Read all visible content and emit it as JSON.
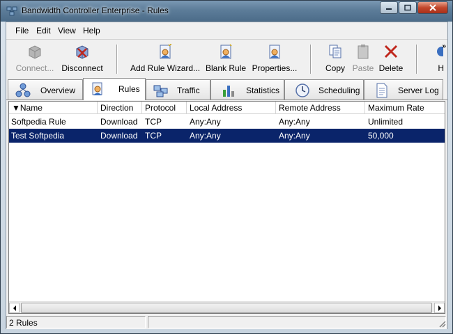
{
  "window": {
    "title": "Bandwidth Controller Enterprise - Rules"
  },
  "menu": {
    "file": "File",
    "edit": "Edit",
    "view": "View",
    "help": "Help"
  },
  "toolbar": {
    "connect": "Connect...",
    "disconnect": "Disconnect",
    "add_rule_wizard": "Add Rule Wizard...",
    "blank_rule": "Blank Rule",
    "properties": "Properties...",
    "copy": "Copy",
    "paste": "Paste",
    "delete": "Delete",
    "help": "H",
    "overflow": "»"
  },
  "tabs": [
    {
      "label": "Overview"
    },
    {
      "label": "Rules"
    },
    {
      "label": "Traffic"
    },
    {
      "label": "Statistics"
    },
    {
      "label": "Scheduling"
    },
    {
      "label": "Server Log"
    }
  ],
  "active_tab": "Rules",
  "list": {
    "sort_indicator": "▼",
    "columns": [
      "Name",
      "Direction",
      "Protocol",
      "Local Address",
      "Remote Address",
      "Maximum Rate"
    ],
    "rows": [
      {
        "name": "Softpedia Rule",
        "direction": "Download",
        "protocol": "TCP",
        "local": "Any:Any",
        "remote": "Any:Any",
        "rate": "Unlimited",
        "selected": false
      },
      {
        "name": "Test Softpedia",
        "direction": "Download",
        "protocol": "TCP",
        "local": "Any:Any",
        "remote": "Any:Any",
        "rate": "50,000",
        "selected": true
      }
    ]
  },
  "status": {
    "count": "2 Rules"
  },
  "colors": {
    "selection": "#0a246a",
    "titlebar": "#5d7d99",
    "delete_red": "#c0281e"
  }
}
